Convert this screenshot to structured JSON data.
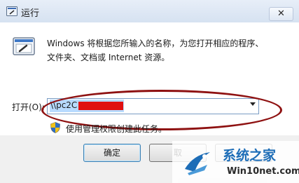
{
  "window": {
    "title": "运行",
    "close_glyph": "✕"
  },
  "description": {
    "line1": "Windows 将根据您所输入的名称，为您打开相应的程序、",
    "line2": "文件夹、文档或 Internet 资源。"
  },
  "open": {
    "label": "打开(O):",
    "value": "\\\\pc2C"
  },
  "admin_note": "使用管理权限创建此任务。",
  "buttons": {
    "ok": "确定",
    "cancel": "取"
  },
  "watermark": {
    "name": "系统之家",
    "domain": "Win10net.com"
  },
  "colors": {
    "annotation": "#8e1111",
    "redaction": "#e01010",
    "watermark_blue": "#1d6db7"
  },
  "icons": [
    "run-app-icon",
    "close-icon",
    "run-program-icon",
    "dropdown-arrow-icon",
    "uac-shield-icon",
    "watermark-logo-icon"
  ]
}
